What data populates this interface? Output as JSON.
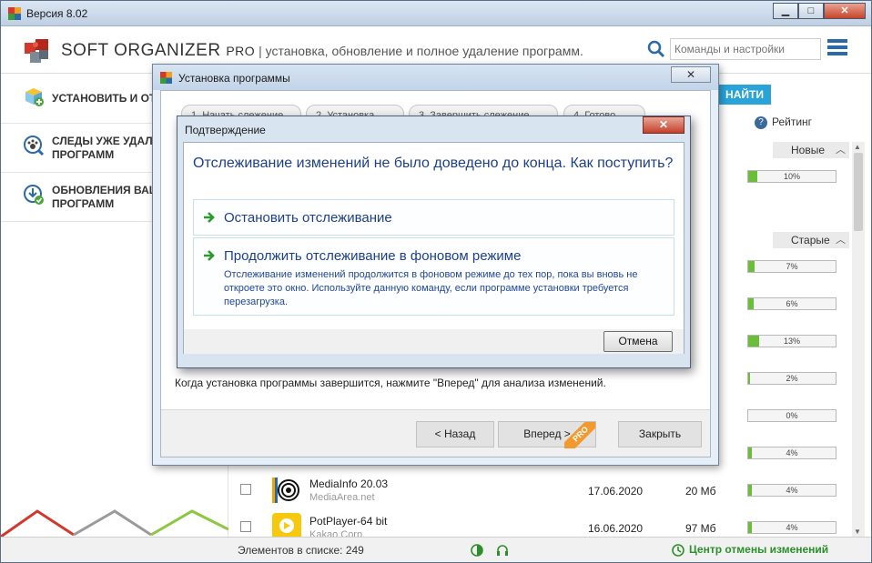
{
  "window": {
    "title": "Версия 8.02",
    "minimize_label": "▁",
    "maximize_label": "□",
    "close_label": "✕"
  },
  "header": {
    "brand": "SOFT ORGANIZER",
    "pro": "PRO",
    "tagline": " | установка, обновление и полное удаление программ.",
    "search_placeholder": "Команды и настройки"
  },
  "sidebar": {
    "items": [
      {
        "label": "Установить и отс",
        "icon": "install-box-icon"
      },
      {
        "label": "Следы уже удаленных программ",
        "icon": "paw-traces-icon"
      },
      {
        "label": "Обновления ваших программ",
        "icon": "update-download-icon"
      }
    ]
  },
  "content": {
    "find_label": "НАЙТИ",
    "rating_label": "Рейтинг",
    "group_new": "Новые",
    "group_old": "Старые",
    "ratings": [
      "10%",
      "7%",
      "6%",
      "13%",
      "2%",
      "0%",
      "4%",
      "4%",
      "4%"
    ],
    "rating_values": [
      10,
      7,
      6,
      13,
      2,
      0,
      4,
      4,
      4
    ],
    "programs": [
      {
        "name": "MediaInfo 20.03",
        "vendor": "MediaArea.net",
        "date": "17.06.2020",
        "size": "20 Мб"
      },
      {
        "name": "PotPlayer-64 bit",
        "vendor": "Kakao Corp.",
        "date": "16.06.2020",
        "size": "97 Мб"
      }
    ]
  },
  "status": {
    "count": "Элементов в списке: 249",
    "undo_center": "Центр отмены изменений"
  },
  "install_dialog": {
    "title": "Установка программы",
    "close_label": "✕",
    "steps": [
      "1. Начать слежение",
      "2. Установка",
      "3. Завершить слежение",
      "4. Готово"
    ],
    "hint": "Когда установка программы завершится, нажмите \"Вперед\" для анализа изменений.",
    "back_label": "< Назад",
    "forward_label": "Вперед >",
    "forward_badge": "PRO",
    "close_button_label": "Закрыть"
  },
  "confirm_dialog": {
    "title": "Подтверждение",
    "close_label": "✕",
    "question": "Отслеживание изменений не было доведено до конца. Как поступить?",
    "option_stop": "Остановить отслеживание",
    "option_continue": "Продолжить отслеживание в фоновом режиме",
    "option_continue_desc": "Отслеживание изменений продолжится в фоновом режиме до тех пор, пока вы вновь не откроете это окно. Используйте данную команду, если программе установки требуется перезагрузка.",
    "cancel_label": "Отмена"
  },
  "colors": {
    "accent_blue": "#2b6aa6",
    "find_button": "#29a3d8",
    "progress_green": "#6cbd3b",
    "link_blue": "#1e3f8f",
    "undo_green": "#2c8f2c",
    "pro_orange": "#f29a2e"
  }
}
